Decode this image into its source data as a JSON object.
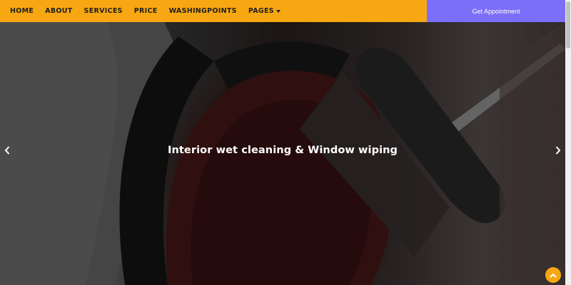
{
  "nav": {
    "items": [
      {
        "label": "HOME"
      },
      {
        "label": "ABOUT"
      },
      {
        "label": "SERVICES"
      },
      {
        "label": "PRICE"
      },
      {
        "label": "WASHINGPOINTS"
      },
      {
        "label": "PAGES"
      }
    ],
    "cta_label": "Get Appointment"
  },
  "hero": {
    "caption": "Interior wet cleaning & Window wiping",
    "prev_icon": "chevron-left-icon",
    "next_icon": "chevron-right-icon"
  },
  "colors": {
    "nav_bg": "#f7a711",
    "cta_bg": "#7b6ef7",
    "back_to_top_bg": "#f7a711"
  },
  "icons": {
    "back_to_top": "chevron-up-icon",
    "dropdown": "caret-down-icon"
  }
}
